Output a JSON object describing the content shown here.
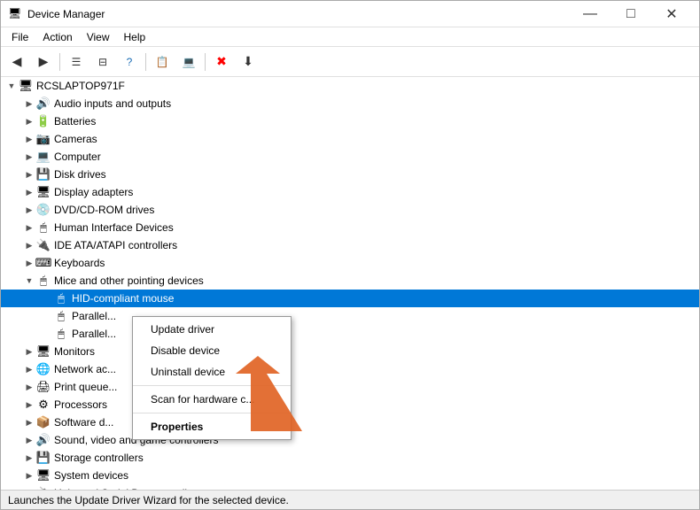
{
  "window": {
    "title": "Device Manager",
    "icon": "🖥"
  },
  "menu": {
    "items": [
      "File",
      "Action",
      "View",
      "Help"
    ]
  },
  "toolbar": {
    "buttons": [
      "◀",
      "▶",
      "☰",
      "⊟",
      "?",
      "📋",
      "💻",
      "🖥",
      "✖",
      "⬇"
    ]
  },
  "tree": {
    "root": "RCSLAPTOP971F",
    "items": [
      {
        "id": "audio",
        "label": "Audio inputs and outputs",
        "icon": "🔊",
        "indent": 1,
        "expanded": false
      },
      {
        "id": "batteries",
        "label": "Batteries",
        "icon": "🔋",
        "indent": 1,
        "expanded": false
      },
      {
        "id": "cameras",
        "label": "Cameras",
        "icon": "📷",
        "indent": 1,
        "expanded": false
      },
      {
        "id": "computer",
        "label": "Computer",
        "icon": "💻",
        "indent": 1,
        "expanded": false
      },
      {
        "id": "diskdrives",
        "label": "Disk drives",
        "icon": "💾",
        "indent": 1,
        "expanded": false
      },
      {
        "id": "displayadapters",
        "label": "Display adapters",
        "icon": "🖥",
        "indent": 1,
        "expanded": false
      },
      {
        "id": "dvdcdrom",
        "label": "DVD/CD-ROM drives",
        "icon": "💿",
        "indent": 1,
        "expanded": false
      },
      {
        "id": "hid",
        "label": "Human Interface Devices",
        "icon": "🖱",
        "indent": 1,
        "expanded": false
      },
      {
        "id": "ideata",
        "label": "IDE ATA/ATAPI controllers",
        "icon": "🔌",
        "indent": 1,
        "expanded": false
      },
      {
        "id": "keyboards",
        "label": "Keyboards",
        "icon": "⌨",
        "indent": 1,
        "expanded": false
      },
      {
        "id": "mice",
        "label": "Mice and other pointing devices",
        "icon": "🖱",
        "indent": 1,
        "expanded": true
      },
      {
        "id": "hid-mouse",
        "label": "HID-compliant mouse",
        "icon": "🖱",
        "indent": 2,
        "expanded": false,
        "selected": true
      },
      {
        "id": "parallel1",
        "label": "Parallel...",
        "icon": "🖱",
        "indent": 2,
        "expanded": false
      },
      {
        "id": "parallel2",
        "label": "Parallel...",
        "icon": "🖱",
        "indent": 2,
        "expanded": false
      },
      {
        "id": "monitors",
        "label": "Monitors",
        "icon": "🖥",
        "indent": 1,
        "expanded": false
      },
      {
        "id": "networkac",
        "label": "Network ac...",
        "icon": "🌐",
        "indent": 1,
        "expanded": false
      },
      {
        "id": "printqueue",
        "label": "Print queue...",
        "icon": "🖨",
        "indent": 1,
        "expanded": false
      },
      {
        "id": "processors",
        "label": "Processors",
        "icon": "⚙",
        "indent": 1,
        "expanded": false
      },
      {
        "id": "softwaredev",
        "label": "Software d...",
        "icon": "📦",
        "indent": 1,
        "expanded": false
      },
      {
        "id": "soundvideo",
        "label": "Sound, video and game controllers",
        "icon": "🔊",
        "indent": 1,
        "expanded": false
      },
      {
        "id": "storagecontrollers",
        "label": "Storage controllers",
        "icon": "💾",
        "indent": 1,
        "expanded": false
      },
      {
        "id": "systemdevices",
        "label": "System devices",
        "icon": "🖥",
        "indent": 1,
        "expanded": false
      },
      {
        "id": "usb",
        "label": "Universal Serial Bus controllers",
        "icon": "🔌",
        "indent": 1,
        "expanded": false
      }
    ]
  },
  "context_menu": {
    "items": [
      {
        "id": "update-driver",
        "label": "Update driver",
        "bold": false,
        "separator_after": false
      },
      {
        "id": "disable-device",
        "label": "Disable device",
        "bold": false,
        "separator_after": false
      },
      {
        "id": "uninstall-device",
        "label": "Uninstall device",
        "bold": false,
        "separator_after": true
      },
      {
        "id": "scan-hardware",
        "label": "Scan for hardware c...",
        "bold": false,
        "separator_after": true
      },
      {
        "id": "properties",
        "label": "Properties",
        "bold": true,
        "separator_after": false
      }
    ]
  },
  "status_bar": {
    "text": "Launches the Update Driver Wizard for the selected device."
  }
}
